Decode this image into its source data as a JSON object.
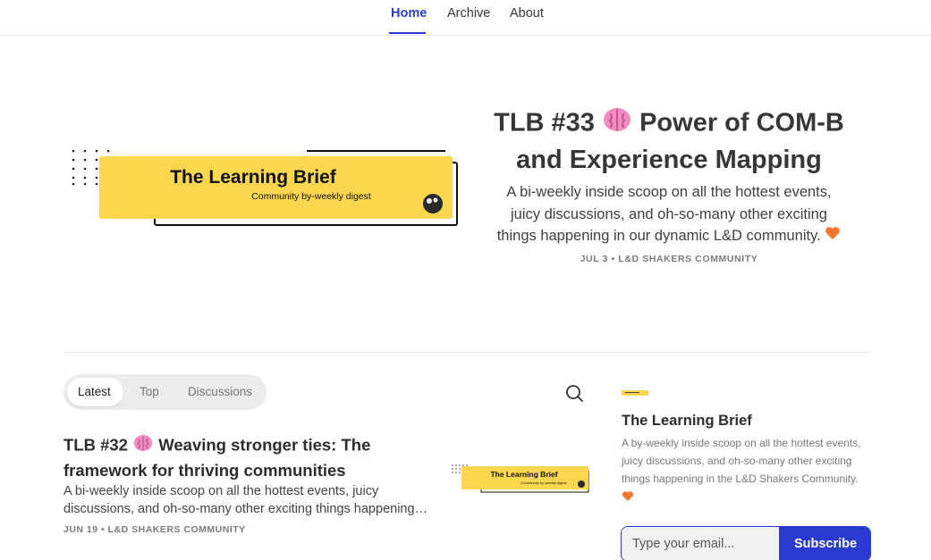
{
  "nav": {
    "items": [
      {
        "label": "Home",
        "active": true
      },
      {
        "label": "Archive",
        "active": false
      },
      {
        "label": "About",
        "active": false
      }
    ]
  },
  "hero": {
    "image": {
      "title": "The Learning Brief",
      "subtitle": "Community by-weekly digest"
    },
    "title_text": "TLB #33",
    "title_emoji": "brain-icon",
    "title_rest": "Power of COM-B and Experience Mapping",
    "description": "A bi-weekly inside scoop on all the hottest events, juicy discussions, and oh-so-many other exciting things happening in our dynamic L&D community.",
    "description_emoji": "orange-heart-icon",
    "meta": "JUL 3 • L&D SHAKERS COMMUNITY"
  },
  "feed": {
    "tabs": [
      {
        "label": "Latest",
        "active": true
      },
      {
        "label": "Top",
        "active": false
      },
      {
        "label": "Discussions",
        "active": false
      }
    ],
    "search_icon": "search-icon",
    "posts": [
      {
        "title_prefix": "TLB #32",
        "title_emoji": "brain-icon",
        "title_rest": "Weaving stronger ties: The framework for thriving communities",
        "description": "A bi-weekly inside scoop on all the hottest events, juicy discussions, and oh-so-many other exciting things happening…",
        "meta": "JUN 19 • L&D SHAKERS COMMUNITY",
        "thumb_title": "The Learning Brief",
        "thumb_subtitle": "Community by-weekly digest"
      }
    ]
  },
  "sidebar": {
    "title": "The Learning Brief",
    "description": "A by-weekly inside scoop on all the hottest events, juicy discussions, and oh-so-many other exciting things happening in the L&D Shakers Community.",
    "heart_icon": "orange-heart-icon",
    "subscribe": {
      "placeholder": "Type your email...",
      "button": "Subscribe"
    }
  },
  "colors": {
    "accent": "#2b3bd1",
    "banner_yellow": "#fbd64e",
    "heart": "#f2772e",
    "brain": "#f08dc3"
  }
}
